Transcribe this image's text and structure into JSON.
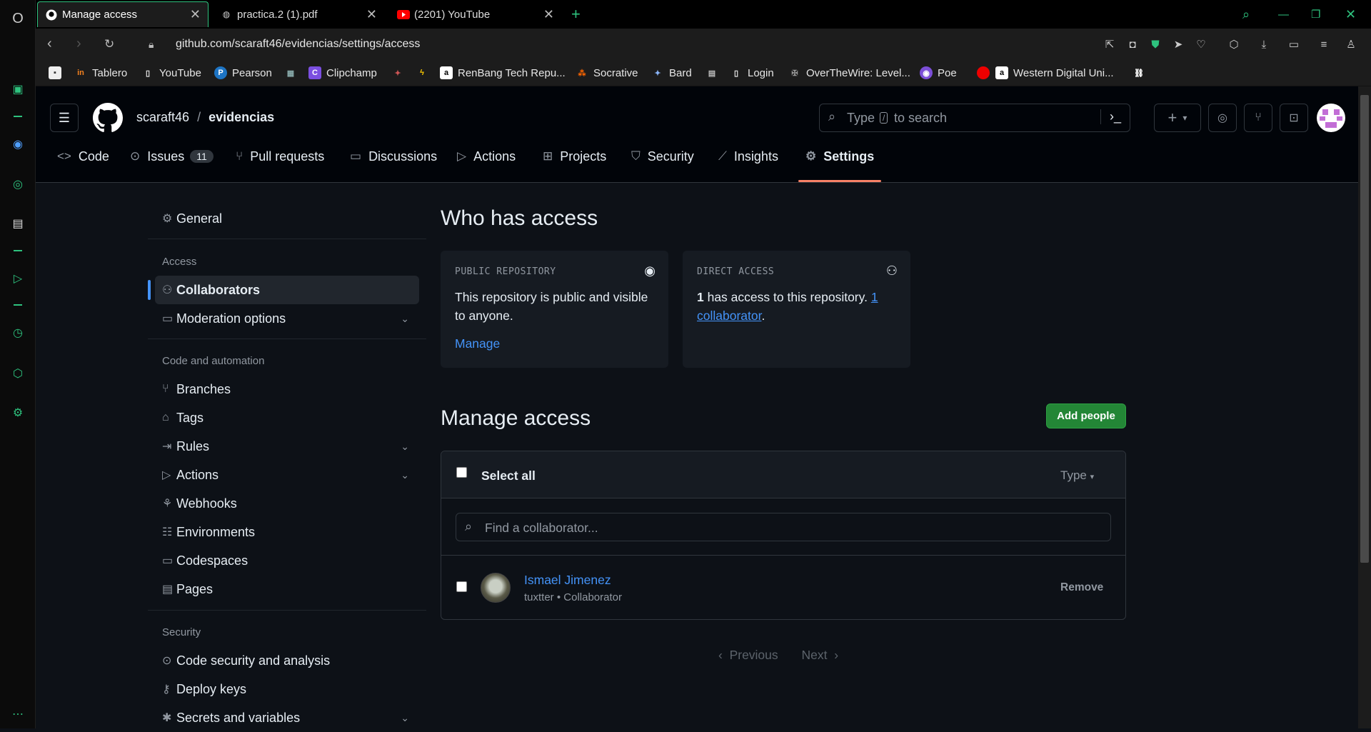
{
  "browser": {
    "tabs": [
      {
        "label": "Manage access",
        "active": true,
        "favicon": "github-icon"
      },
      {
        "label": "practica.2 (1).pdf",
        "active": false,
        "favicon": "globe-icon"
      },
      {
        "label": "(2201) YouTube",
        "active": false,
        "favicon": "youtube-icon"
      }
    ],
    "url": "github.com/scaraft46/evidencias/settings/access",
    "bookmarks": [
      {
        "label": "",
        "icon": "page-icon"
      },
      {
        "label": "Tablero",
        "icon": "instructure-icon"
      },
      {
        "label": "YouTube",
        "icon": "page-icon"
      },
      {
        "label": "Pearson",
        "icon": "pearson-icon"
      },
      {
        "label": "",
        "icon": "app-icon"
      },
      {
        "label": "Clipchamp",
        "icon": "clipchamp-icon"
      },
      {
        "label": "",
        "icon": "game-icon"
      },
      {
        "label": "",
        "icon": "bolt-icon"
      },
      {
        "label": "RenBang Tech Repu...",
        "icon": "amazon-icon"
      },
      {
        "label": "Socrative",
        "icon": "socrative-icon"
      },
      {
        "label": "Bard",
        "icon": "bard-icon"
      },
      {
        "label": "",
        "icon": "keyboard-icon"
      },
      {
        "label": "Login",
        "icon": "page-icon"
      },
      {
        "label": "OverTheWire: Level...",
        "icon": "otw-icon"
      },
      {
        "label": "Poe",
        "icon": "poe-icon"
      },
      {
        "label": "",
        "icon": "red-dot-icon"
      },
      {
        "label": "Western Digital Uni...",
        "icon": "amazon-icon"
      },
      {
        "label": "",
        "icon": "link-icon"
      }
    ]
  },
  "header": {
    "owner": "scaraft46",
    "separator": "/",
    "repo": "evidencias",
    "search_prefix": "Type",
    "search_key": "/",
    "search_suffix": "to search",
    "plus": "+",
    "caret": "▾"
  },
  "repo_tabs": [
    {
      "label": "Code",
      "icon": "code-icon"
    },
    {
      "label": "Issues",
      "icon": "issue-icon",
      "count": "11"
    },
    {
      "label": "Pull requests",
      "icon": "pull-request-icon"
    },
    {
      "label": "Discussions",
      "icon": "discussion-icon"
    },
    {
      "label": "Actions",
      "icon": "play-icon"
    },
    {
      "label": "Projects",
      "icon": "table-icon"
    },
    {
      "label": "Security",
      "icon": "shield-icon"
    },
    {
      "label": "Insights",
      "icon": "graph-icon"
    },
    {
      "label": "Settings",
      "icon": "gear-icon",
      "active": true
    }
  ],
  "settings_nav": {
    "general": "General",
    "access_heading": "Access",
    "collaborators": "Collaborators",
    "moderation": "Moderation options",
    "code_heading": "Code and automation",
    "branches": "Branches",
    "tags": "Tags",
    "rules": "Rules",
    "actions": "Actions",
    "webhooks": "Webhooks",
    "environments": "Environments",
    "codespaces": "Codespaces",
    "pages": "Pages",
    "security_heading": "Security",
    "code_security": "Code security and analysis",
    "deploy_keys": "Deploy keys",
    "secrets": "Secrets and variables"
  },
  "who_has_access": {
    "title": "Who has access",
    "public_card": {
      "heading": "PUBLIC REPOSITORY",
      "body": "This repository is public and visible to anyone.",
      "link": "Manage"
    },
    "direct_card": {
      "heading": "DIRECT ACCESS",
      "count": "1",
      "body": " has access to this repository. ",
      "link": "1 collaborator",
      "tail": "."
    }
  },
  "manage_access": {
    "title": "Manage access",
    "add_button": "Add people",
    "select_all": "Select all",
    "type_filter": "Type",
    "search_placeholder": "Find a collaborator...",
    "collaborators": [
      {
        "name": "Ismael Jimenez",
        "username": "tuxtter",
        "role": "Collaborator",
        "action": "Remove"
      }
    ],
    "meta_sep": " • ",
    "pagination": {
      "previous": "Previous",
      "next": "Next"
    }
  }
}
